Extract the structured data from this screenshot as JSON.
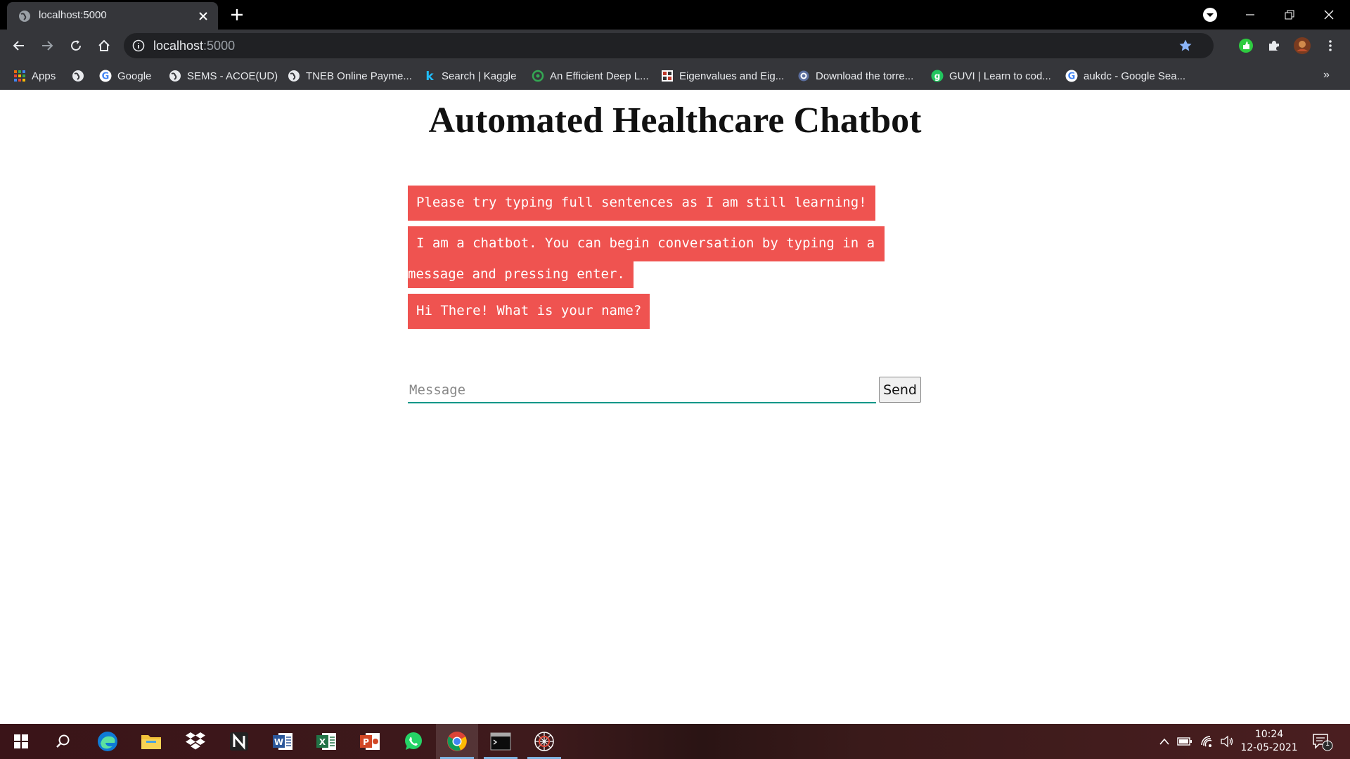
{
  "browser": {
    "tab_title": "localhost:5000",
    "url_host": "localhost",
    "url_port": ":5000",
    "bookmarks": [
      {
        "label": "Apps",
        "icon": "apps-grid-icon"
      },
      {
        "label": "",
        "icon": "globe-icon"
      },
      {
        "label": "Google",
        "icon": "google-icon"
      },
      {
        "label": "SEMS - ACOE(UD)",
        "icon": "globe-icon"
      },
      {
        "label": "TNEB Online Payme...",
        "icon": "globe-icon"
      },
      {
        "label": "Search | Kaggle",
        "icon": "kaggle-icon"
      },
      {
        "label": "An Efficient Deep L...",
        "icon": "research-icon"
      },
      {
        "label": "Eigenvalues and Eig...",
        "icon": "calculator-icon"
      },
      {
        "label": "Download the torre...",
        "icon": "gear-icon"
      },
      {
        "label": "GUVI | Learn to cod...",
        "icon": "guvi-icon"
      },
      {
        "label": "aukdc - Google Sea...",
        "icon": "google-icon"
      }
    ],
    "more_label": "»"
  },
  "page": {
    "title": "Automated Healthcare Chatbot",
    "messages": [
      "Please try typing full sentences as I am still learning!",
      "I am a chatbot. You can begin conversation by typing in a",
      "message and pressing enter.",
      "Hi There! What is your name?"
    ],
    "input_placeholder": "Message",
    "send_label": "Send"
  },
  "taskbar": {
    "time": "10:24",
    "date": "12-05-2021",
    "notification_count": "1",
    "apps": [
      "windows-start-icon",
      "search-icon",
      "edge-icon",
      "file-explorer-icon",
      "dropbox-icon",
      "notion-icon",
      "word-icon",
      "excel-icon",
      "powerpoint-icon",
      "whatsapp-icon",
      "chrome-icon",
      "terminal-icon",
      "spider-app-icon"
    ]
  },
  "colors": {
    "bubble": "#ef5350",
    "input_underline": "#009688",
    "chrome_dark": "#35363a",
    "tabstrip": "#000000"
  }
}
